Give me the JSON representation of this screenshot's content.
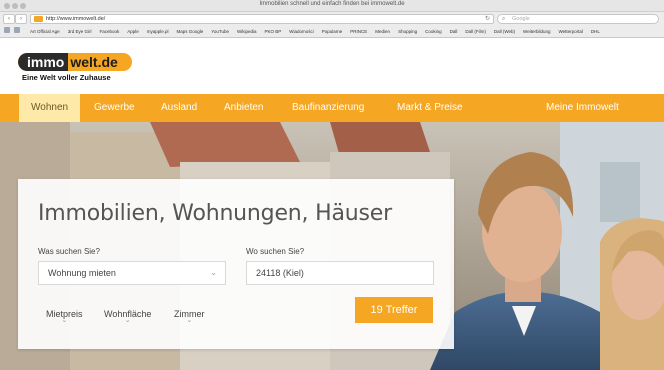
{
  "browser": {
    "window_title": "Immobilien schnell und einfach finden bei immowelt.de",
    "url": "http://www.immowelt.de/",
    "search_placeholder": "Google",
    "bookmarks": [
      "Art Official Age",
      "3rd Eye Girl",
      "Facebook",
      "Apple",
      "myapple.pl",
      "Maps Google",
      "YouTube",
      "Wikipedia",
      "PKO BP",
      "Wiadomości",
      "Popularne",
      "PRINCE",
      "Medien",
      "Shopping",
      "Cooking",
      "Dall",
      "Dall (Film)",
      "Dall (Web)",
      "Weiterbildung",
      "Wetterportal",
      "DHL"
    ]
  },
  "site": {
    "logo_dark": "immo",
    "logo_light": "welt.de",
    "tagline": "Eine Welt voller Zuhause"
  },
  "nav": {
    "items": [
      "Wohnen",
      "Gewerbe",
      "Ausland",
      "Anbieten",
      "Baufinanzierung",
      "Markt & Preise"
    ],
    "right": "Meine Immowelt"
  },
  "search": {
    "headline": "Immobilien, Wohnungen, Häuser",
    "what_label": "Was suchen Sie?",
    "what_value": "Wohnung mieten",
    "where_label": "Wo suchen Sie?",
    "where_value": "24118 (Kiel)",
    "filters": [
      "Mietpreis",
      "Wohnfläche",
      "Zimmer"
    ],
    "button": "19 Treffer"
  },
  "colors": {
    "accent": "#f5a623",
    "nav_active": "#ffe9a8"
  }
}
